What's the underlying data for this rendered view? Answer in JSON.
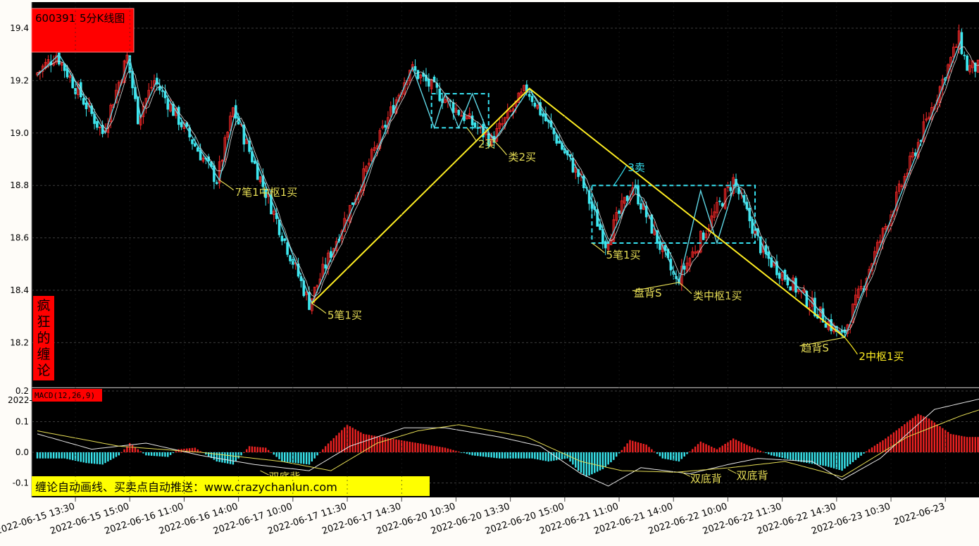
{
  "header": {
    "ticker": "600391",
    "chart_title": "5分K线图"
  },
  "side_banner": {
    "chars": [
      "疯",
      "狂",
      "的",
      "缠",
      "论"
    ]
  },
  "macd": {
    "label": "MACD(12,26,9)",
    "stub": "2022-"
  },
  "promo": {
    "text": "缠论自动画线、买卖点自动推送：www.crazychanlun.com"
  },
  "colors": {
    "bg": "#000000",
    "up": "#ff2a2a",
    "down": "#3ce8f0",
    "stroke": "#5fd8e6",
    "segment": "#ffee22",
    "annotation": "#e6dd55",
    "zhongshu": "#36e0f0",
    "title_badge": "#ff0000",
    "promo_bg": "#ffff00"
  },
  "chart_data": {
    "type": "candlestick",
    "price_axis": {
      "ylim": [
        18.1,
        19.5
      ],
      "ticks": [
        19.4,
        19.2,
        19.0,
        18.8,
        18.6,
        18.4,
        18.2
      ]
    },
    "macd_axis": {
      "ylim": [
        -0.125,
        0.2
      ],
      "ticks": [
        0.2,
        0.1,
        0.0,
        -0.1
      ],
      "tick_labels": [
        "0.2",
        "0.1",
        "0.0",
        "-0.1"
      ]
    },
    "x_ticks": [
      {
        "i": 14,
        "label": "2022-06-15 13:30"
      },
      {
        "i": 34,
        "label": "2022-06-15 15:00"
      },
      {
        "i": 54,
        "label": "2022-06-16 11:00"
      },
      {
        "i": 74,
        "label": "2022-06-16 14:00"
      },
      {
        "i": 94,
        "label": "2022-06-17 10:00"
      },
      {
        "i": 114,
        "label": "2022-06-17 11:30"
      },
      {
        "i": 134,
        "label": "2022-06-17 14:30"
      },
      {
        "i": 154,
        "label": "2022-06-20 10:30"
      },
      {
        "i": 174,
        "label": "2022-06-20 13:30"
      },
      {
        "i": 194,
        "label": "2022-06-20 15:00"
      },
      {
        "i": 214,
        "label": "2022-06-21 11:00"
      },
      {
        "i": 234,
        "label": "2022-06-21 14:00"
      },
      {
        "i": 254,
        "label": "2022-06-22 10:00"
      },
      {
        "i": 274,
        "label": "2022-06-22 11:30"
      },
      {
        "i": 294,
        "label": "2022-06-22 14:30"
      },
      {
        "i": 314,
        "label": "2022-06-23 10:30"
      },
      {
        "i": 334,
        "label": "2022-06-23"
      }
    ],
    "pivots": [
      [
        0,
        19.22
      ],
      [
        8,
        19.3
      ],
      [
        25,
        19.0
      ],
      [
        34,
        19.29
      ],
      [
        38,
        19.06
      ],
      [
        44,
        19.2
      ],
      [
        67,
        18.82
      ],
      [
        73,
        19.09
      ],
      [
        101,
        18.35
      ],
      [
        138,
        19.25
      ],
      [
        168,
        18.97
      ],
      [
        181,
        19.17
      ],
      [
        201,
        18.82
      ],
      [
        210,
        18.58
      ],
      [
        220,
        18.8
      ],
      [
        236,
        18.43
      ],
      [
        257,
        18.82
      ],
      [
        268,
        18.54
      ],
      [
        297,
        18.22
      ],
      [
        340,
        19.36
      ],
      [
        343,
        19.25
      ]
    ],
    "segments": [
      [
        101,
        18.35
      ],
      [
        181,
        19.17
      ],
      [
        297,
        18.22
      ]
    ],
    "bi_strokes": [
      [
        [
          0,
          19.22
        ],
        [
          8,
          19.3
        ],
        [
          25,
          19.0
        ],
        [
          34,
          19.29
        ],
        [
          38,
          19.06
        ],
        [
          44,
          19.2
        ],
        [
          67,
          18.82
        ],
        [
          73,
          19.09
        ],
        [
          101,
          18.35
        ],
        [
          138,
          19.25
        ],
        [
          146,
          19.02
        ],
        [
          150,
          19.15
        ],
        [
          155,
          19.02
        ],
        [
          160,
          19.15
        ],
        [
          165,
          19.02
        ],
        [
          168,
          18.97
        ],
        [
          181,
          19.17
        ],
        [
          201,
          18.82
        ],
        [
          210,
          18.58
        ],
        [
          220,
          18.8
        ],
        [
          236,
          18.43
        ],
        [
          244,
          18.78
        ],
        [
          250,
          18.58
        ],
        [
          257,
          18.82
        ],
        [
          268,
          18.54
        ],
        [
          297,
          18.22
        ],
        [
          340,
          19.36
        ]
      ]
    ],
    "zhongshu": [
      {
        "x0": 145,
        "x1": 166,
        "y_low": 19.02,
        "y_high": 19.15
      },
      {
        "x0": 204,
        "x1": 264,
        "y_low": 18.58,
        "y_high": 18.8
      }
    ],
    "annotations": [
      {
        "text": "7笔1中枢1买",
        "i": 67,
        "price": 18.82,
        "dx": 22,
        "dy": 22,
        "color": "#e6dd55"
      },
      {
        "text": "5笔1买",
        "i": 101,
        "price": 18.35,
        "dx": 22,
        "dy": 22,
        "color": "#e6dd55"
      },
      {
        "text": "2买",
        "i": 158,
        "price": 19.02,
        "dx": 16,
        "dy": 28,
        "color": "#e6dd55"
      },
      {
        "text": "类2买",
        "i": 168,
        "price": 18.97,
        "dx": 20,
        "dy": 28,
        "color": "#e6dd55"
      },
      {
        "text": "3卖",
        "i": 212,
        "price": 18.8,
        "dx": 20,
        "dy": -20,
        "color": "#36e0f0"
      },
      {
        "text": "5笔1买",
        "i": 204,
        "price": 18.58,
        "dx": 20,
        "dy": 22,
        "color": "#e6dd55"
      },
      {
        "text": "盘背S",
        "i": 236,
        "price": 18.43,
        "dx": -64,
        "dy": 20,
        "color": "#e6dd55"
      },
      {
        "text": "类中枢1买",
        "i": 236,
        "price": 18.43,
        "dx": 20,
        "dy": 24,
        "color": "#e6dd55"
      },
      {
        "text": "趋背S",
        "i": 297,
        "price": 18.22,
        "dx": -62,
        "dy": 20,
        "color": "#e6dd55"
      },
      {
        "text": "2中枢1买",
        "i": 297,
        "price": 18.22,
        "dx": 20,
        "dy": 32,
        "color": "#ffee22"
      }
    ],
    "macd_annotations": [
      {
        "text": "双底背",
        "i": 82,
        "v": -0.06,
        "dx": 12,
        "dy": 0
      },
      {
        "text": "双底背",
        "i": 237,
        "v": -0.065,
        "dx": 12,
        "dy": 0
      },
      {
        "text": "双底背",
        "i": 254,
        "v": -0.055,
        "dx": 12,
        "dy": 0
      }
    ],
    "macd_hist_peaks": [
      [
        0,
        -0.02
      ],
      [
        10,
        -0.02
      ],
      [
        18,
        -0.035
      ],
      [
        24,
        -0.04
      ],
      [
        30,
        -0.01
      ],
      [
        34,
        0.03
      ],
      [
        40,
        -0.01
      ],
      [
        48,
        -0.015
      ],
      [
        52,
        0.01
      ],
      [
        58,
        0.015
      ],
      [
        66,
        -0.03
      ],
      [
        72,
        -0.04
      ],
      [
        78,
        0.02
      ],
      [
        84,
        0.015
      ],
      [
        90,
        -0.03
      ],
      [
        100,
        -0.04
      ],
      [
        106,
        0.02
      ],
      [
        114,
        0.09
      ],
      [
        120,
        0.06
      ],
      [
        140,
        0.03
      ],
      [
        150,
        0.015
      ],
      [
        160,
        -0.01
      ],
      [
        170,
        -0.02
      ],
      [
        182,
        -0.02
      ],
      [
        188,
        -0.03
      ],
      [
        195,
        -0.02
      ],
      [
        199,
        -0.06
      ],
      [
        202,
        -0.08
      ],
      [
        208,
        -0.055
      ],
      [
        212,
        -0.025
      ],
      [
        218,
        0.04
      ],
      [
        224,
        0.025
      ],
      [
        230,
        -0.02
      ],
      [
        236,
        -0.03
      ],
      [
        244,
        0.035
      ],
      [
        250,
        0.01
      ],
      [
        256,
        0.045
      ],
      [
        262,
        0.02
      ],
      [
        270,
        -0.01
      ],
      [
        280,
        -0.03
      ],
      [
        290,
        -0.045
      ],
      [
        296,
        -0.06
      ],
      [
        306,
        0.01
      ],
      [
        312,
        0.045
      ],
      [
        324,
        0.125
      ],
      [
        328,
        0.11
      ],
      [
        336,
        0.06
      ],
      [
        342,
        0.05
      ],
      [
        347,
        0.05
      ]
    ],
    "dif_points": [
      [
        0,
        0.06
      ],
      [
        20,
        0.01
      ],
      [
        40,
        0.03
      ],
      [
        60,
        -0.01
      ],
      [
        80,
        -0.04
      ],
      [
        100,
        -0.06
      ],
      [
        115,
        0.02
      ],
      [
        135,
        0.08
      ],
      [
        150,
        0.08
      ],
      [
        170,
        0.05
      ],
      [
        185,
        0.02
      ],
      [
        200,
        -0.07
      ],
      [
        210,
        -0.11
      ],
      [
        222,
        -0.05
      ],
      [
        240,
        -0.07
      ],
      [
        254,
        -0.04
      ],
      [
        265,
        -0.02
      ],
      [
        285,
        -0.03
      ],
      [
        296,
        -0.09
      ],
      [
        310,
        -0.02
      ],
      [
        330,
        0.14
      ],
      [
        347,
        0.175
      ]
    ],
    "dea_points": [
      [
        0,
        0.07
      ],
      [
        30,
        0.02
      ],
      [
        60,
        0.0
      ],
      [
        90,
        -0.03
      ],
      [
        108,
        -0.06
      ],
      [
        125,
        0.03
      ],
      [
        140,
        0.07
      ],
      [
        155,
        0.09
      ],
      [
        180,
        0.05
      ],
      [
        200,
        -0.03
      ],
      [
        215,
        -0.06
      ],
      [
        235,
        -0.065
      ],
      [
        255,
        -0.05
      ],
      [
        275,
        -0.03
      ],
      [
        296,
        -0.08
      ],
      [
        320,
        0.05
      ],
      [
        340,
        0.12
      ],
      [
        347,
        0.14
      ]
    ]
  }
}
